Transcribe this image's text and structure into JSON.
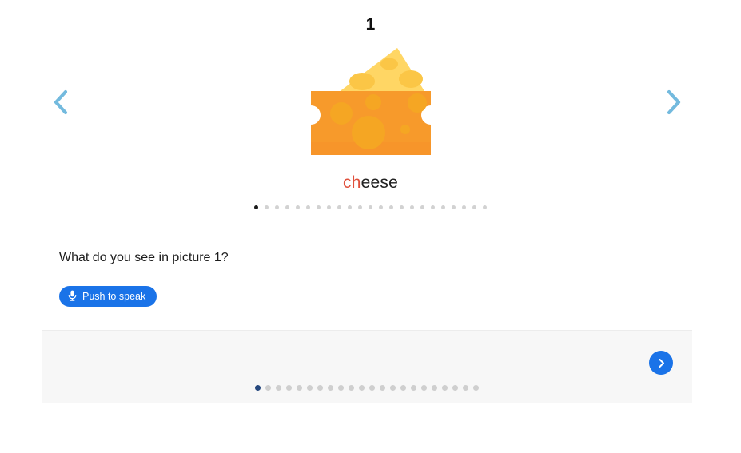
{
  "carousel": {
    "slide_number": "1",
    "prev_icon": "chevron-left-icon",
    "next_icon": "chevron-right-icon",
    "picture": {
      "icon": "cheese-wedge-icon",
      "alt": "cheese",
      "colors": {
        "top_face": "#ffd15c",
        "top_face_light": "#ffdd80",
        "body": "#f79a2b",
        "body_shade": "#f58b1f",
        "hole": "#f5a623",
        "hole_top": "#f7b733"
      }
    },
    "word": {
      "onset": "ch",
      "rime": "eese",
      "onset_color": "#e0503c",
      "rime_color": "#212121"
    },
    "dots_count": 23,
    "dots_active_index": 0
  },
  "question": {
    "text": "What do you see in picture 1?"
  },
  "speak_button": {
    "label": "Push to speak",
    "icon": "microphone-icon",
    "color": "#1a73e8"
  },
  "bottom_bar": {
    "next_button": {
      "icon": "chevron-right-icon",
      "label": "Next",
      "color": "#1a73e8"
    },
    "dots_count": 22,
    "dots_active_index": 0,
    "dots_active_color": "#26487e"
  }
}
